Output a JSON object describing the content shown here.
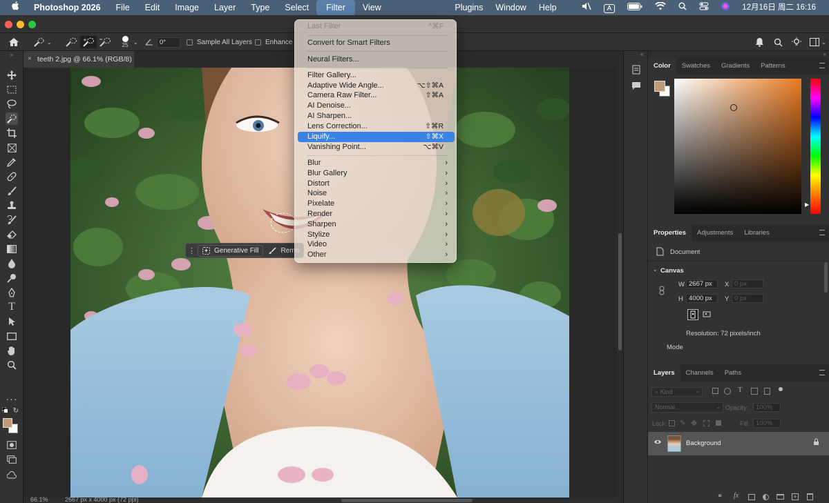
{
  "menubar": {
    "apple": "",
    "app": "Photoshop 2026",
    "items": [
      "File",
      "Edit",
      "Image",
      "Layer",
      "Type",
      "Select",
      "Filter",
      "View"
    ],
    "right_items": [
      "Plugins",
      "Window",
      "Help"
    ],
    "input_indicator": "A",
    "datetime": "12月16日 周二  16:16"
  },
  "options": {
    "brush_size": "25",
    "angle": "0°",
    "sample_all_layers": "Sample All Layers",
    "enhance": "Enhance"
  },
  "doc_tab": {
    "title": "teeth 2.jpg @ 66.1% (RGB/8)"
  },
  "context_bar": {
    "generative_fill": "Generative Fill",
    "remove": "Remo"
  },
  "filter_menu": {
    "items": [
      {
        "label": "Last Filter",
        "shortcut": "^⌘F",
        "disabled": true
      },
      {
        "label": "Convert for Smart Filters"
      },
      {
        "label": "Neural Filters..."
      },
      {
        "label": "Filter Gallery..."
      },
      {
        "label": "Adaptive Wide Angle...",
        "shortcut": "⌥⇧⌘A"
      },
      {
        "label": "Camera Raw Filter...",
        "shortcut": "⇧⌘A"
      },
      {
        "label": "AI Denoise..."
      },
      {
        "label": "AI Sharpen..."
      },
      {
        "label": "Lens Correction...",
        "shortcut": "⇧⌘R"
      },
      {
        "label": "Liquify...",
        "shortcut": "⇧⌘X",
        "highlighted": true
      },
      {
        "label": "Vanishing Point...",
        "shortcut": "⌥⌘V"
      },
      {
        "label": "Blur",
        "submenu": true
      },
      {
        "label": "Blur Gallery",
        "submenu": true
      },
      {
        "label": "Distort",
        "submenu": true
      },
      {
        "label": "Noise",
        "submenu": true
      },
      {
        "label": "Pixelate",
        "submenu": true
      },
      {
        "label": "Render",
        "submenu": true
      },
      {
        "label": "Sharpen",
        "submenu": true
      },
      {
        "label": "Stylize",
        "submenu": true
      },
      {
        "label": "Video",
        "submenu": true
      },
      {
        "label": "Other",
        "submenu": true
      }
    ]
  },
  "color_panel": {
    "tabs": [
      "Color",
      "Swatches",
      "Gradients",
      "Patterns"
    ],
    "foreground": "#c19a78",
    "background": "#ffffff",
    "hue": "#e87a20"
  },
  "properties_panel": {
    "tabs": [
      "Properties",
      "Adjustments",
      "Libraries"
    ],
    "kind": "Document",
    "section": "Canvas",
    "w_label": "W",
    "w_value": "2667 px",
    "h_label": "H",
    "h_value": "4000 px",
    "x_label": "X",
    "x_value": "0 px",
    "y_label": "Y",
    "y_value": "0 px",
    "resolution": "Resolution: 72 pixels/inch",
    "mode": "Mode"
  },
  "layers_panel": {
    "tabs": [
      "Layers",
      "Channels",
      "Paths"
    ],
    "filter_placeholder": "Kind",
    "blend_mode": "Normal",
    "opacity_label": "Opacity:",
    "opacity_value": "100%",
    "lock_label": "Lock:",
    "fill_label": "Fill:",
    "fill_value": "100%",
    "layer_name": "Background"
  },
  "status": {
    "zoom": "66.1%",
    "doc_info": "2667 px x 4000 px (72 ppi)"
  }
}
